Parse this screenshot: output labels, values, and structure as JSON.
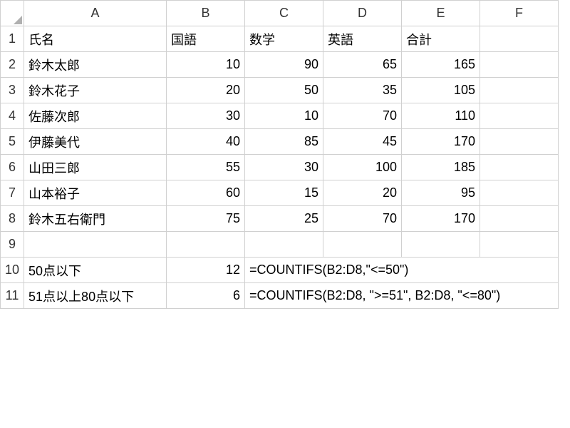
{
  "columns": [
    "A",
    "B",
    "C",
    "D",
    "E",
    "F"
  ],
  "rows": [
    "1",
    "2",
    "3",
    "4",
    "5",
    "6",
    "7",
    "8",
    "9",
    "10",
    "11"
  ],
  "header": {
    "name": "氏名",
    "kokugo": "国語",
    "sugaku": "数学",
    "eigo": "英語",
    "gokei": "合計"
  },
  "students": [
    {
      "name": "鈴木太郎",
      "b": "10",
      "c": "90",
      "d": "65",
      "e": "165",
      "hl": {
        "b": "o",
        "d": "b"
      }
    },
    {
      "name": "鈴木花子",
      "b": "20",
      "c": "50",
      "d": "35",
      "e": "105",
      "hl": {
        "b": "o",
        "c": "o",
        "d": "b"
      }
    },
    {
      "name": "佐藤次郎",
      "b": "30",
      "c": "10",
      "d": "70",
      "e": "110",
      "hl": {
        "b": "o",
        "c": "o",
        "d": "b"
      }
    },
    {
      "name": "伊藤美代",
      "b": "40",
      "c": "85",
      "d": "45",
      "e": "170",
      "hl": {
        "b": "o",
        "d": "b"
      }
    },
    {
      "name": "山田三郎",
      "b": "55",
      "c": "30",
      "d": "100",
      "e": "185",
      "hl": {
        "b": "b",
        "c": "o"
      }
    },
    {
      "name": "山本裕子",
      "b": "60",
      "c": "15",
      "d": "20",
      "e": "95",
      "hl": {
        "b": "b",
        "c": "o",
        "d": "b"
      }
    },
    {
      "name": "鈴木五右衛門",
      "b": "75",
      "c": "25",
      "d": "70",
      "e": "170",
      "hl": {
        "b": "b",
        "c": "o",
        "d": "b"
      }
    }
  ],
  "summary": [
    {
      "label": "50点以下",
      "count": "12",
      "formula": "=COUNTIFS(B2:D8,\"<=50\")"
    },
    {
      "label": "51点以上80点以下",
      "count": "6",
      "formula": "=COUNTIFS(B2:D8, \">=51\", B2:D8, \"<=80\")"
    }
  ],
  "chart_data": {
    "type": "table",
    "title": "",
    "columns": [
      "氏名",
      "国語",
      "数学",
      "英語",
      "合計"
    ],
    "rows": [
      [
        "鈴木太郎",
        10,
        90,
        65,
        165
      ],
      [
        "鈴木花子",
        20,
        50,
        35,
        105
      ],
      [
        "佐藤次郎",
        30,
        10,
        70,
        110
      ],
      [
        "伊藤美代",
        40,
        85,
        45,
        170
      ],
      [
        "山田三郎",
        55,
        30,
        100,
        185
      ],
      [
        "山本裕子",
        60,
        15,
        20,
        95
      ],
      [
        "鈴木五右衛門",
        75,
        25,
        70,
        170
      ]
    ],
    "aggregates": [
      {
        "label": "50点以下",
        "value": 12
      },
      {
        "label": "51点以上80点以下",
        "value": 6
      }
    ]
  }
}
